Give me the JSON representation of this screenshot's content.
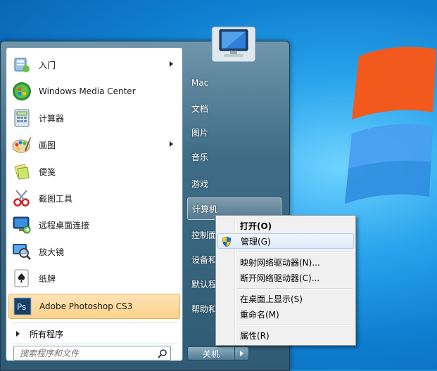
{
  "programs": [
    {
      "label": "入门",
      "icon": "getting-started-icon",
      "has_submenu": true
    },
    {
      "label": "Windows Media Center",
      "icon": "windows-media-center-icon",
      "has_submenu": false
    },
    {
      "label": "计算器",
      "icon": "calculator-icon",
      "has_submenu": false
    },
    {
      "label": "画图",
      "icon": "paint-icon",
      "has_submenu": true
    },
    {
      "label": "便笺",
      "icon": "sticky-notes-icon",
      "has_submenu": false
    },
    {
      "label": "截图工具",
      "icon": "snipping-tool-icon",
      "has_submenu": false
    },
    {
      "label": "远程桌面连接",
      "icon": "remote-desktop-icon",
      "has_submenu": false
    },
    {
      "label": "放大镜",
      "icon": "magnifier-icon",
      "has_submenu": false
    },
    {
      "label": "纸牌",
      "icon": "solitaire-icon",
      "has_submenu": false
    },
    {
      "label": "Adobe Photoshop CS3",
      "icon": "photoshop-icon",
      "has_submenu": false
    }
  ],
  "all_programs_label": "所有程序",
  "search": {
    "placeholder": "搜索程序和文件"
  },
  "right_links": [
    {
      "label": "Mac"
    },
    {
      "label": "文档"
    },
    {
      "label": "图片"
    },
    {
      "label": "音乐"
    },
    {
      "label": "游戏"
    },
    {
      "label": "计算机"
    },
    {
      "label": "控制面"
    },
    {
      "label": "设备和"
    },
    {
      "label": "默认程"
    },
    {
      "label": "帮助和"
    }
  ],
  "shutdown_label": "关机",
  "context_menu": {
    "items": [
      {
        "label": "打开(O)",
        "bold": true
      },
      {
        "label": "管理(G)",
        "icon": "uac-shield-icon"
      },
      {
        "label": "映射网络驱动器(N)..."
      },
      {
        "label": "断开网络驱动器(C)..."
      },
      {
        "label": "在桌面上显示(S)"
      },
      {
        "label": "重命名(M)"
      },
      {
        "label": "属性(R)"
      }
    ]
  },
  "colors": {
    "highlight": "#fbd28a",
    "menu_frame": "#3f6c86",
    "desktop": "#1a8fd8"
  }
}
